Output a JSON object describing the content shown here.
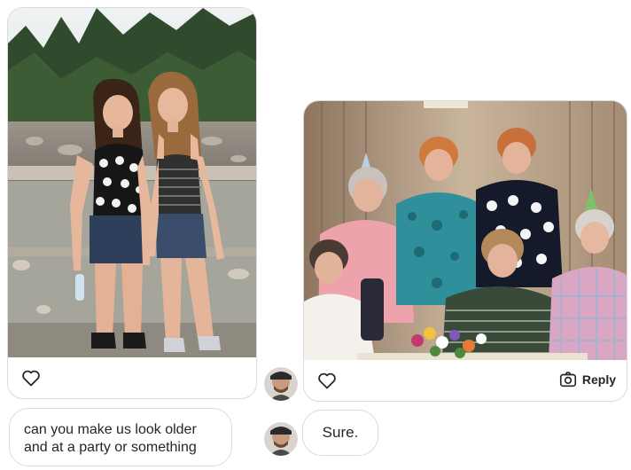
{
  "thread": {
    "user_message": {
      "line1": "can you make us look older",
      "line2": "and at a party or something"
    },
    "reply_message": {
      "text": "Sure."
    },
    "photo_card": {
      "reply_label": "Reply"
    }
  },
  "icons": {
    "like": "heart-icon",
    "camera": "camera-icon"
  },
  "colors": {
    "border": "#dbdbdb",
    "text": "#262626",
    "background": "#ffffff"
  }
}
